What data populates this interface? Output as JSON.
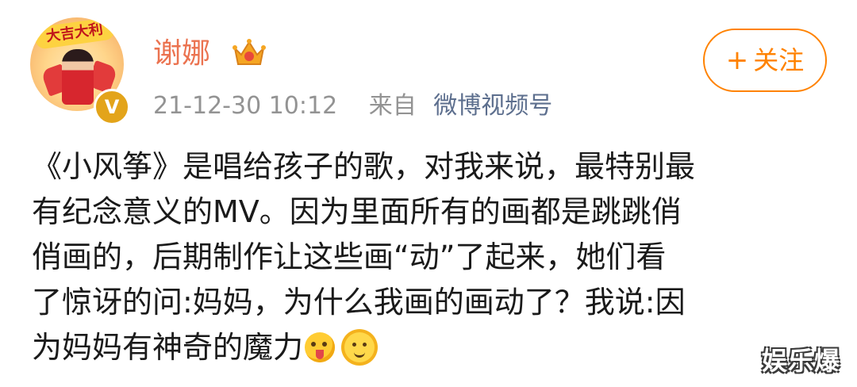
{
  "header": {
    "avatar_banner": "大吉大利",
    "username": "谢娜",
    "verified_badge": "V",
    "timestamp": "21-12-30 10:12",
    "from_label": "来自",
    "source": "微博视频号",
    "follow_label": "关注",
    "follow_plus": "+"
  },
  "post": {
    "lines": [
      "《小风筝》是唱给孩子的歌，对我来说，最特别最",
      "有纪念意义的MV。因为里面所有的画都是跳跳俏",
      "俏画的，后期制作让这些画“动”了起来，她们看",
      "了惊讶的问:妈妈，为什么我画的画动了？我说:因",
      "为妈妈有神奇的魔力"
    ],
    "emojis": [
      "tongue-out-emoji",
      "sun-face-emoji"
    ]
  },
  "watermark": "娱乐爆",
  "colors": {
    "username": "#eb7350",
    "follow": "#ff8200",
    "meta": "#939393",
    "source": "#5d6f8e",
    "crown": "#f5a623"
  }
}
